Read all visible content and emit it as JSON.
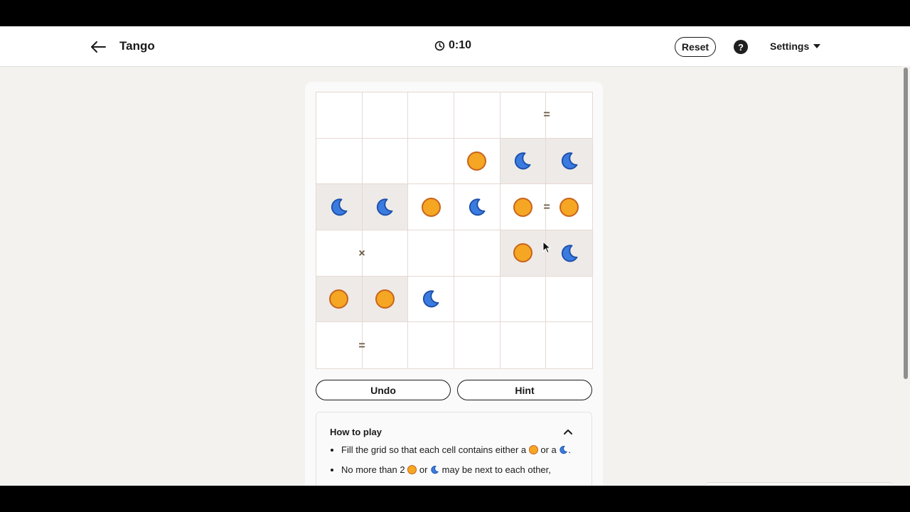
{
  "header": {
    "title": "Tango",
    "timer": "0:10",
    "reset_label": "Reset",
    "help_label": "?",
    "settings_label": "Settings"
  },
  "board": {
    "rows": 6,
    "cols": 6,
    "cells": [
      [
        "",
        "",
        "",
        "",
        "",
        ""
      ],
      [
        "",
        "",
        "",
        "sun",
        "moon",
        "moon"
      ],
      [
        "moon",
        "moon",
        "sun",
        "moon",
        "sun",
        "sun"
      ],
      [
        "",
        "",
        "",
        "",
        "sun",
        "moon"
      ],
      [
        "sun",
        "sun",
        "moon",
        "",
        "",
        ""
      ],
      [
        "",
        "",
        "",
        "",
        "",
        ""
      ]
    ],
    "locked": [
      [
        false,
        false,
        false,
        false,
        false,
        false
      ],
      [
        false,
        false,
        false,
        false,
        true,
        true
      ],
      [
        true,
        true,
        false,
        false,
        false,
        false
      ],
      [
        false,
        false,
        false,
        false,
        true,
        true
      ],
      [
        true,
        true,
        false,
        false,
        false,
        false
      ],
      [
        false,
        false,
        false,
        false,
        false,
        false
      ]
    ],
    "constraints": [
      {
        "type": "=",
        "between": [
          [
            0,
            4
          ],
          [
            0,
            5
          ]
        ]
      },
      {
        "type": "=",
        "between": [
          [
            2,
            4
          ],
          [
            2,
            5
          ]
        ]
      },
      {
        "type": "×",
        "between": [
          [
            3,
            0
          ],
          [
            3,
            1
          ]
        ]
      },
      {
        "type": "=",
        "between": [
          [
            5,
            0
          ],
          [
            5,
            1
          ]
        ]
      }
    ]
  },
  "actions": {
    "undo_label": "Undo",
    "hint_label": "Hint"
  },
  "how_to_play": {
    "title": "How to play",
    "rule1_before": "Fill the grid so that each cell contains either a",
    "rule1_mid": "or a",
    "rule1_after": ".",
    "rule2_before": "No more than 2",
    "rule2_mid": "or",
    "rule2_after": "may be next to each other,"
  },
  "colors": {
    "sun_fill": "#f5a623",
    "sun_stroke": "#c8641c",
    "moon_fill": "#3a7be0",
    "moon_stroke": "#1d4fa8",
    "locked_cell": "#eeeae7"
  }
}
